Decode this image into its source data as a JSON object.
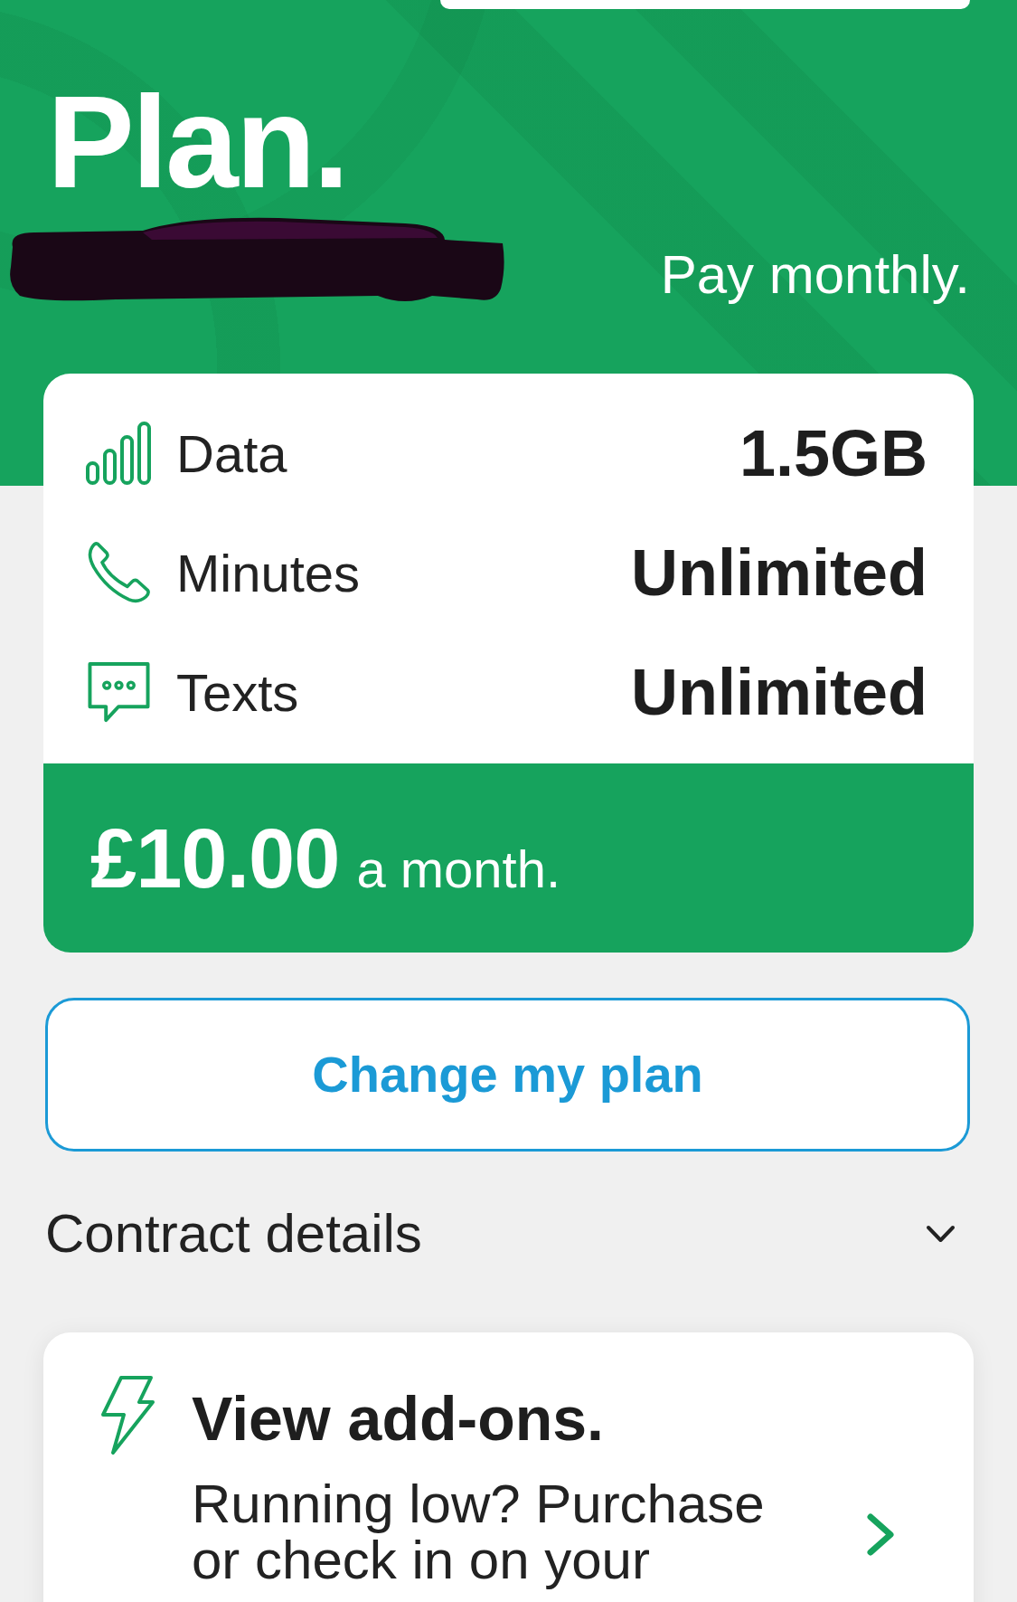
{
  "header": {
    "title": "Plan.",
    "plan_type": "Pay monthly."
  },
  "allowances": [
    {
      "kind": "data",
      "label": "Data",
      "value": "1.5GB"
    },
    {
      "kind": "minutes",
      "label": "Minutes",
      "value": "Unlimited"
    },
    {
      "kind": "texts",
      "label": "Texts",
      "value": "Unlimited"
    }
  ],
  "price": {
    "amount": "£10.00",
    "period": "a month."
  },
  "change_button": {
    "label": "Change my plan"
  },
  "contract_details": {
    "label": "Contract details",
    "expanded": false
  },
  "addons_card": {
    "title": "View add-ons.",
    "description": "Running low? Purchase or check in on your"
  }
}
